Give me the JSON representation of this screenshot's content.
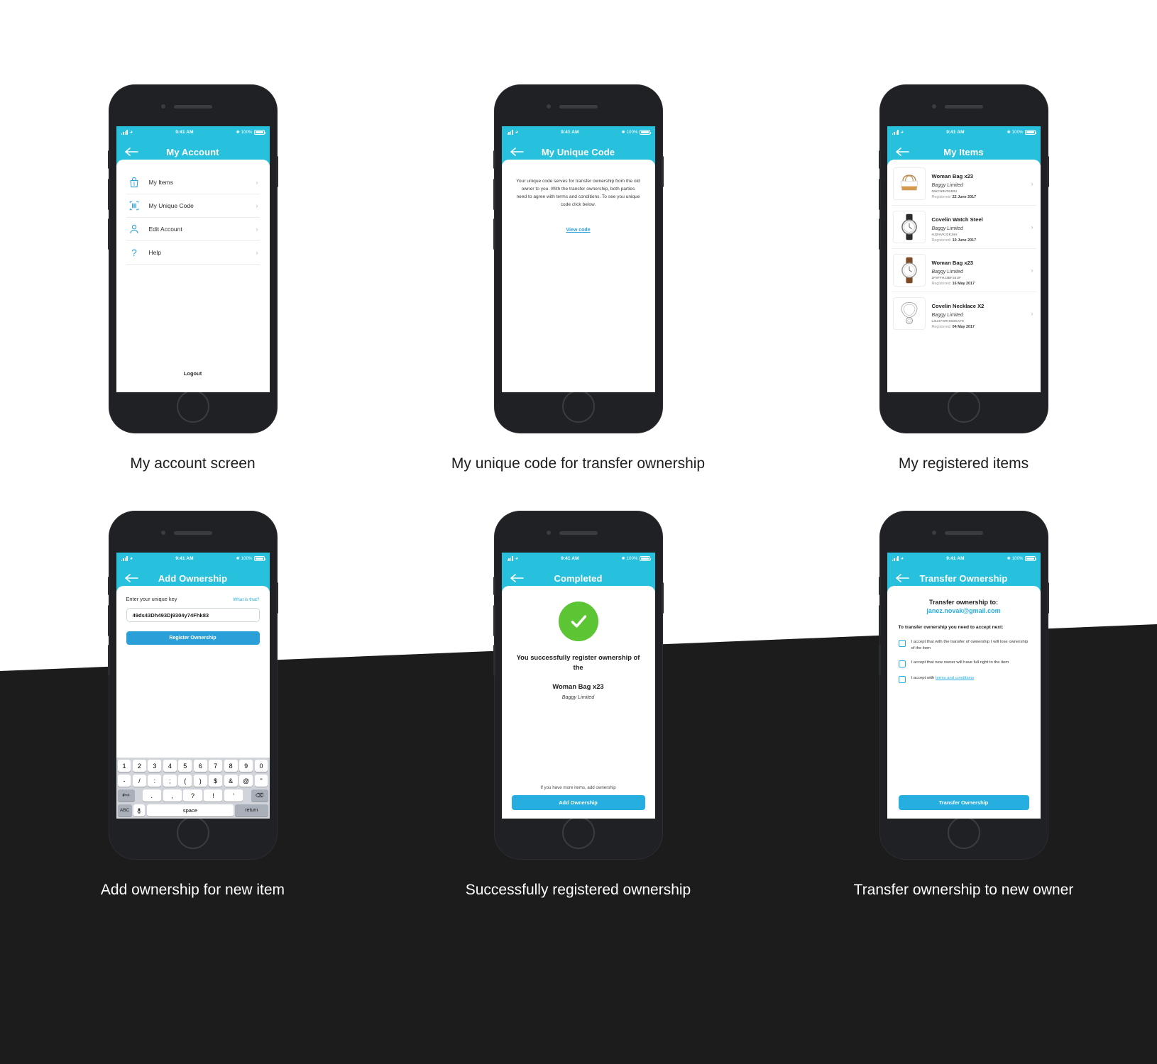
{
  "status_bar": {
    "time": "9:41 AM",
    "battery": "100%"
  },
  "screens": {
    "account": {
      "title": "My Account",
      "caption": "My account screen",
      "items": [
        {
          "label": "My Items",
          "icon": "bag-icon"
        },
        {
          "label": "My Unique Code",
          "icon": "barcode-icon"
        },
        {
          "label": "Edit Account",
          "icon": "user-icon"
        },
        {
          "label": "Help",
          "icon": "question-icon"
        }
      ],
      "logout": "Logout"
    },
    "unique_code": {
      "title": "My Unique Code",
      "caption": "My unique code for transfer ownership",
      "body": "Your unique code serves for transfer ownership from the old owner to you. With the transfer ownership, both parties need to agree with terms and conditions. To see you unique code click below.",
      "link": "View code"
    },
    "items": {
      "title": "My Items",
      "caption": "My registered items",
      "registered_label": "Registered:",
      "list": [
        {
          "name": "Woman Bag x23",
          "brand": "Baggy Limited",
          "code": "NWCNBV9283U",
          "registered": "22 June 2017",
          "thumb": "handbag-thumb"
        },
        {
          "name": "Covelin Watch Steel",
          "brand": "Baggy Limited",
          "code": "HJ2HVKJ3KJ4H",
          "registered": "10 June 2017",
          "thumb": "steel-watch-thumb"
        },
        {
          "name": "Woman Bag x23",
          "brand": "Baggy Limited",
          "code": "2F8FFHJ3BF34UF",
          "registered": "16 May 2017",
          "thumb": "leather-watch-thumb"
        },
        {
          "name": "Covelin Necklace X2",
          "brand": "Baggy Limited",
          "code": "L3U4YGRHGDSAFK",
          "registered": "04 May 2017",
          "thumb": "necklace-thumb"
        }
      ]
    },
    "add_ownership": {
      "title": "Add Ownership",
      "caption": "Add ownership for new item",
      "field_label": "Enter your unique key",
      "help_link": "What is that?",
      "key_value": "49ds43Dh493Dj9304y74Fhk83",
      "submit": "Register Ownership",
      "keyboard": {
        "row1": [
          "1",
          "2",
          "3",
          "4",
          "5",
          "6",
          "7",
          "8",
          "9",
          "0"
        ],
        "row2": [
          "-",
          "/",
          ":",
          ";",
          "(",
          ")",
          "$",
          "&",
          "@",
          "\""
        ],
        "row3_sym": "#+=",
        "row3": [
          ".",
          ",",
          "?",
          "!",
          "'"
        ],
        "row3_del": "⌫",
        "row4_abc": "ABC",
        "row4_mic": "mic-icon",
        "row4_space": "space",
        "row4_return": "return"
      }
    },
    "completed": {
      "title": "Completed",
      "caption": "Successfully registered ownership",
      "headline": "You successfully register ownership of the",
      "item_name": "Woman Bag x23",
      "item_brand": "Baggy Limited",
      "note": "If you have more items, add ownership",
      "button": "Add Ownership"
    },
    "transfer": {
      "title": "Transfer Ownership",
      "caption": "Transfer ownership to new owner",
      "headline": "Transfer ownership to:",
      "email": "janez.novak@gmail.com",
      "sub": "To transfer ownership you need to accept next:",
      "checks": [
        "I accept that with the transfer of ownership I will lose ownership of the item",
        "I accept that new owner will have full right to the item"
      ],
      "check3_prefix": "I accept with ",
      "check3_link": "terms and conditions",
      "button": "Transfer Ownership"
    }
  },
  "colors": {
    "brand": "#27c0dd",
    "accent": "#2b9fd8",
    "success": "#5cc534",
    "dark_band": "#1c1c1c"
  }
}
